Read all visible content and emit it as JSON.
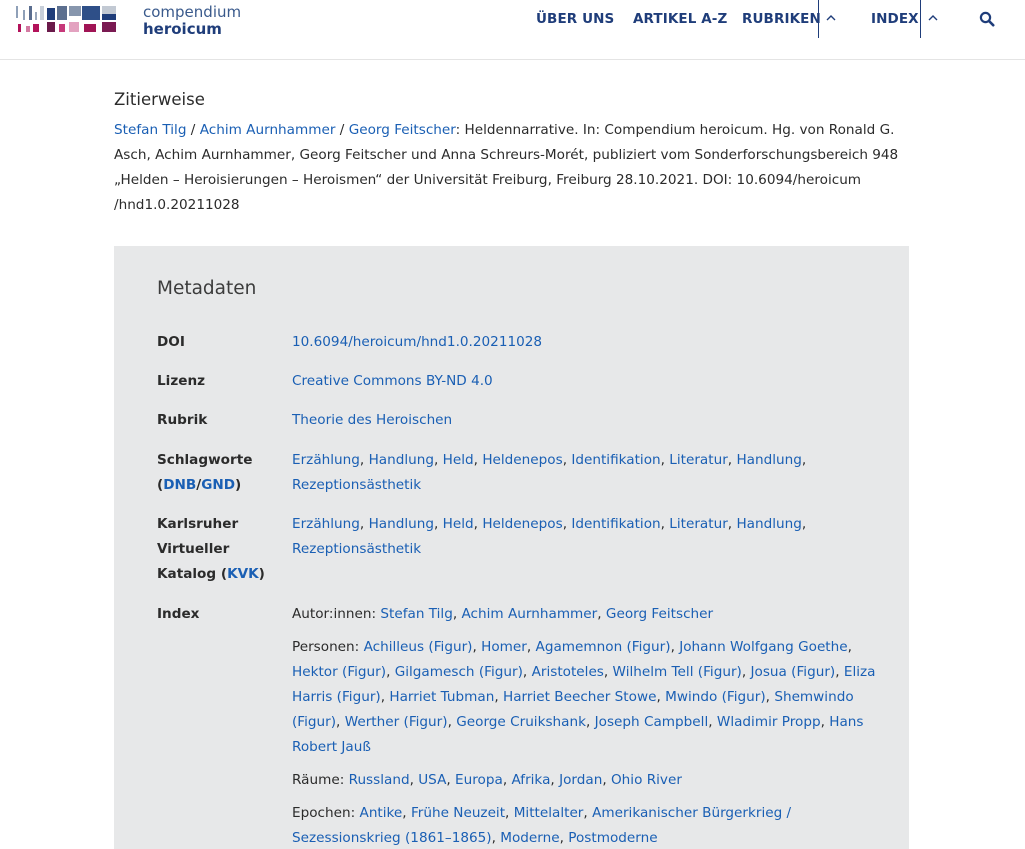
{
  "logo": {
    "line1": "compendium",
    "line2": "heroicum"
  },
  "nav": {
    "items": [
      "ÜBER UNS",
      "ARTIKEL A-Z",
      "RUBRIKEN",
      "INDEX"
    ]
  },
  "citation": {
    "title": "Zitierweise",
    "authors": [
      "Stefan Tilg",
      "Achim Aurnhammer",
      "Georg Feitscher"
    ],
    "sep": " / ",
    "text": ": Heldennarrative. In: Compendium heroicum. Hg. von Ronald G. Asch, Achim Aurnhammer, Georg Feitscher und Anna Schreurs-Morét, publiziert vom Sonderforschungsbereich 948 „Helden – Heroisierungen – Heroismen“ der Universität Freiburg, Freiburg 28.10.2021. DOI: 10.6094/heroicum /hnd1.0.20211028"
  },
  "metadata": {
    "title": "Metadaten",
    "doi": {
      "label": "DOI",
      "value": "10.6094/heroicum/hnd1.0.20211028"
    },
    "lizenz": {
      "label": "Lizenz",
      "value": "Creative Commons BY-ND 4.0"
    },
    "rubrik": {
      "label": "Rubrik",
      "value": "Theorie des Heroischen"
    },
    "schlagworte": {
      "label_prefix": "Schlagworte (",
      "dnb": "DNB",
      "slash": "/",
      "gnd": "GND",
      "label_suffix": ")",
      "values": [
        "Erzählung",
        "Handlung",
        "Held",
        "Heldenepos",
        "Identifikation",
        "Literatur",
        "Handlung",
        "Rezeptionsästhetik"
      ]
    },
    "kvk": {
      "label_prefix": "Karlsruher Virtueller Katalog (",
      "kvk": "KVK",
      "label_suffix": ")",
      "values": [
        "Erzählung",
        "Handlung",
        "Held",
        "Heldenepos",
        "Identifikation",
        "Literatur",
        "Handlung",
        "Rezeptionsästhetik"
      ]
    },
    "index": {
      "label": "Index",
      "groups": [
        {
          "label": "Autor:innen: ",
          "values": [
            "Stefan Tilg",
            "Achim Aurnhammer",
            "Georg Feitscher"
          ]
        },
        {
          "label": "Personen: ",
          "values": [
            "Achilleus (Figur)",
            "Homer",
            "Agamemnon (Figur)",
            "Johann Wolfgang Goethe",
            "Hektor (Figur)",
            "Gilgamesch (Figur)",
            "Aristoteles",
            "Wilhelm Tell (Figur)",
            "Josua (Figur)",
            "Eliza Harris (Figur)",
            "Harriet Tubman",
            "Harriet Beecher Stowe",
            "Mwindo (Figur)",
            "Shemwindo (Figur)",
            "Werther (Figur)",
            "George Cruikshank",
            "Joseph Campbell",
            "Wladimir Propp",
            "Hans Robert Jauß"
          ]
        },
        {
          "label": "Räume: ",
          "values": [
            "Russland",
            "USA",
            "Europa",
            "Afrika",
            "Jordan",
            "Ohio River"
          ]
        },
        {
          "label": "Epochen: ",
          "values": [
            "Antike",
            "Frühe Neuzeit",
            "Mittelalter",
            "Amerikanischer Bürgerkrieg / Sezessionskrieg (1861–1865)",
            "Moderne",
            "Postmoderne"
          ]
        }
      ]
    }
  },
  "colors": {
    "link": "#1a5fb4",
    "navy": "#1f3d7a",
    "box": "#e7e8e9"
  }
}
